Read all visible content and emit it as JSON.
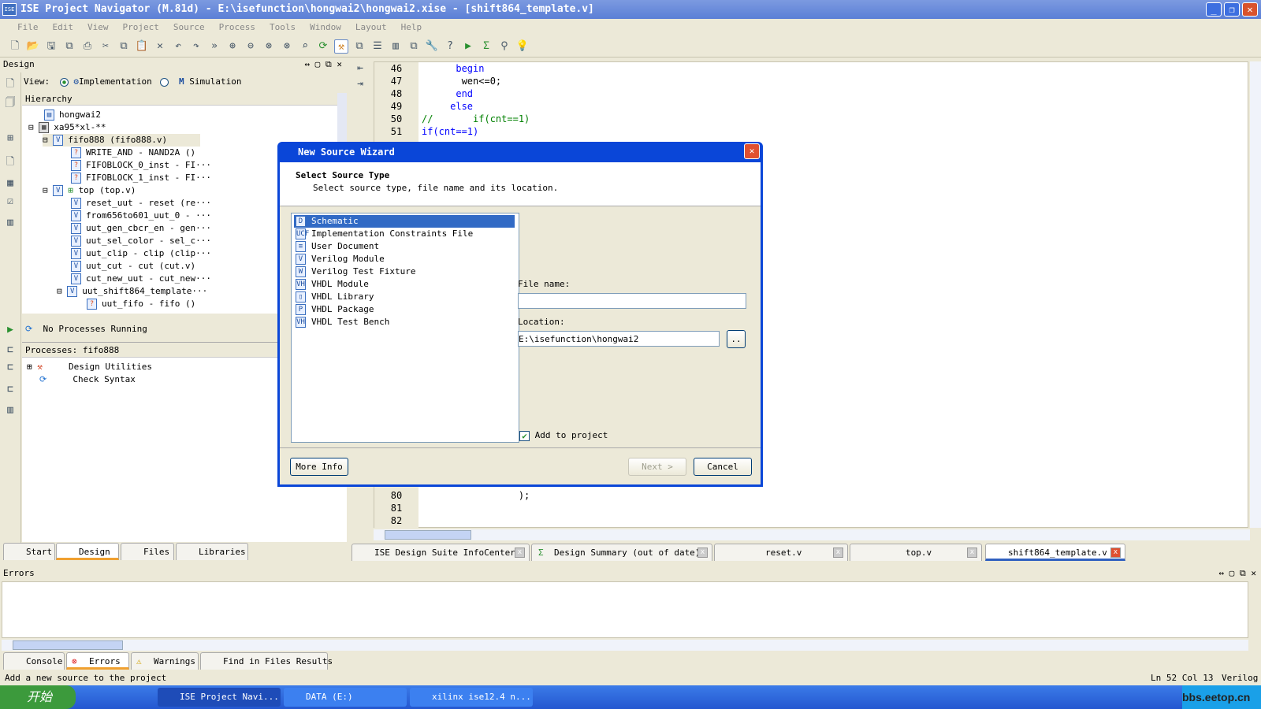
{
  "window": {
    "title": "ISE Project Navigator (M.81d) - E:\\isefunction\\hongwai2\\hongwai2.xise - [shift864_template.v]"
  },
  "menu": [
    "File",
    "Edit",
    "View",
    "Project",
    "Source",
    "Process",
    "Tools",
    "Window",
    "Layout",
    "Help"
  ],
  "design_panel": {
    "title": "Design",
    "view_label": "View:",
    "impl": "Implementation",
    "sim": "Simulation",
    "hierarchy": "Hierarchy",
    "tree": [
      "hongwai2",
      "xa95*xl-**",
      "fifo888 (fifo888.v)",
      "WRITE_AND - NAND2A ()",
      "FIFOBLOCK_0_inst - FI···",
      "FIFOBLOCK_1_inst - FI···",
      "top (top.v)",
      "reset_uut - reset (re···",
      "from656to601_uut_0 - ···",
      "uut_gen_cbcr_en - gen···",
      "uut_sel_color - sel_c···",
      "uut_clip - clip (clip···",
      "uut_cut - cut (cut.v)",
      "cut_new_uut - cut_new···",
      "uut_shift864_template···",
      "uut_fifo - fifo ()"
    ],
    "status": "No Processes Running",
    "processes_header": "Processes: fifo888",
    "processes": [
      "Design Utilities",
      "Check Syntax"
    ],
    "tabs": [
      "Start",
      "Design",
      "Files",
      "Libraries"
    ]
  },
  "editor": {
    "lines": [
      {
        "n": "46",
        "t": "      begin",
        "c": "kw"
      },
      {
        "n": "47",
        "t": "       wen<=0;",
        "c": ""
      },
      {
        "n": "48",
        "t": "      end",
        "c": "kw"
      },
      {
        "n": "49",
        "t": "     else",
        "c": "kw"
      },
      {
        "n": "50",
        "t": "//       if(cnt==1)",
        "c": "cm"
      },
      {
        "n": "51",
        "t": "if(cnt==1)",
        "c": "mix"
      },
      {
        "n": "80",
        "t": "                 );",
        "c": ""
      },
      {
        "n": "81",
        "t": "",
        "c": ""
      },
      {
        "n": "82",
        "t": "",
        "c": ""
      }
    ],
    "tabs": [
      "ISE Design Suite InfoCenter",
      "Design Summary (out of date)",
      "reset.v",
      "top.v",
      "shift864_template.v"
    ]
  },
  "dialog": {
    "title": "New Source Wizard",
    "heading": "Select Source Type",
    "subheading": "Select source type, file name and its location.",
    "types": [
      "Schematic",
      "Implementation Constraints File",
      "User Document",
      "Verilog Module",
      "Verilog Test Fixture",
      "VHDL Module",
      "VHDL Library",
      "VHDL Package",
      "VHDL Test Bench"
    ],
    "type_icons": [
      "D",
      "UCF",
      "≡",
      "V",
      "W",
      "VH",
      "▯",
      "P",
      "VH"
    ],
    "file_name_label": "File name:",
    "file_name_value": "",
    "location_label": "Location:",
    "location_value": "E:\\isefunction\\hongwai2",
    "browse": "..",
    "add_to_project": "Add to project",
    "more_info": "More Info",
    "next": "Next >",
    "cancel": "Cancel"
  },
  "errors_panel": {
    "title": "Errors",
    "tabs": [
      "Console",
      "Errors",
      "Warnings",
      "Find in Files Results"
    ]
  },
  "statusbar": {
    "message": "Add a new source to the project",
    "position": "Ln 52 Col 13",
    "language": "Verilog"
  },
  "taskbar": {
    "start": "开始",
    "tasks": [
      "ISE Project Navi...",
      "DATA (E:)",
      "xilinx ise12.4 n..."
    ],
    "watermark": "bbs.eetop.cn"
  }
}
